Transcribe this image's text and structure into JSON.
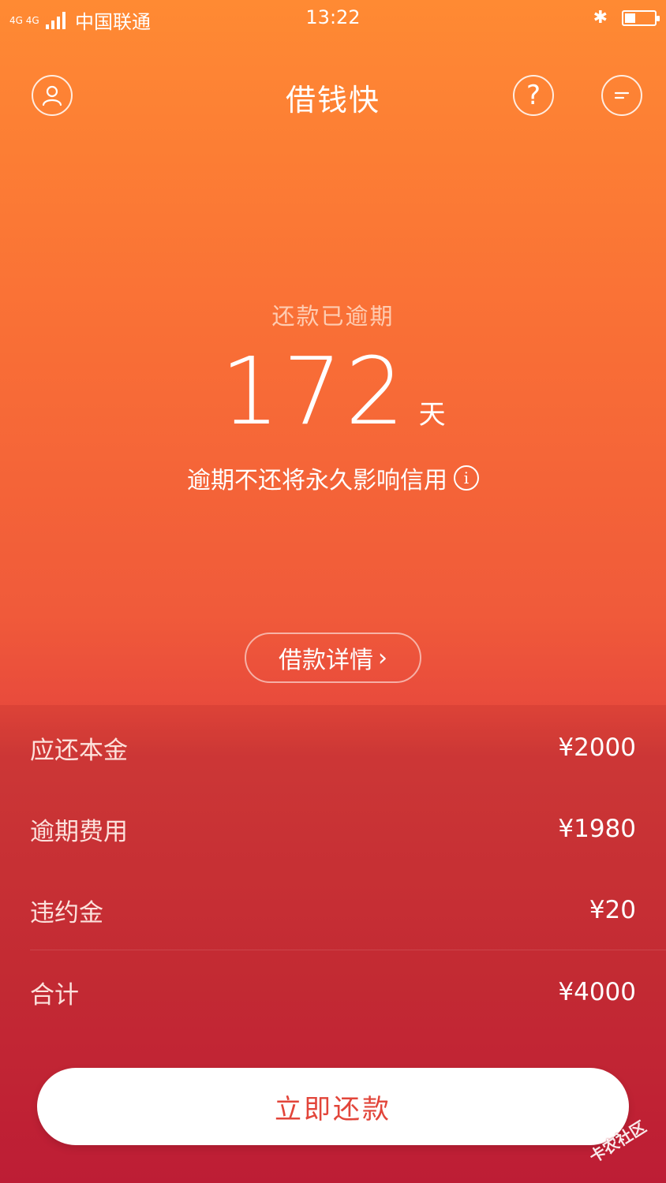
{
  "status_bar": {
    "network": "4G 4G",
    "carrier": "中国联通",
    "time": "13:22",
    "battery_level": 0.35
  },
  "nav": {
    "title": "借钱快"
  },
  "overdue": {
    "label": "还款已逾期",
    "days": "172",
    "unit": "天",
    "warning": "逾期不还将永久影响信用"
  },
  "detail_button": {
    "label": "借款详情",
    "chevron": "›"
  },
  "summary": {
    "rows": [
      {
        "label": "应还本金",
        "value": "¥2000"
      },
      {
        "label": "逾期费用",
        "value": "¥1980"
      },
      {
        "label": "违约金",
        "value": "¥20"
      },
      {
        "label": "合计",
        "value": "¥4000"
      }
    ]
  },
  "pay_button": {
    "label": "立即还款"
  },
  "watermark": "卡农社区",
  "colors": {
    "gradient_top": "#ff8a33",
    "gradient_bottom": "#c51f3a",
    "pay_text": "#e2453a"
  }
}
